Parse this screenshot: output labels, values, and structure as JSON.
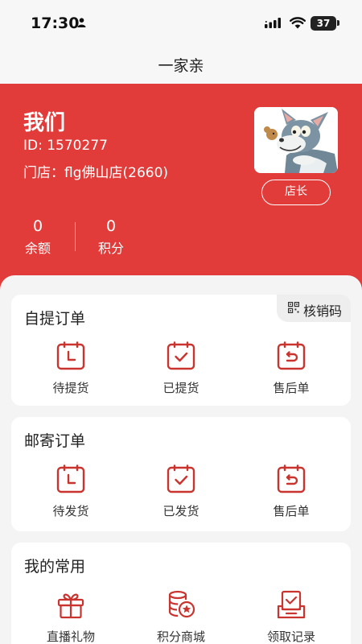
{
  "status_bar": {
    "time": "17:30",
    "battery": "37"
  },
  "nav": {
    "title": "一家亲"
  },
  "profile": {
    "name": "我们",
    "id_line": "ID: 1570277",
    "store_line": "门店：flg佛山店(2660)",
    "role_button": "店长"
  },
  "stats": {
    "balance": {
      "value": "0",
      "label": "余额"
    },
    "points": {
      "value": "0",
      "label": "积分"
    }
  },
  "pickup": {
    "title": "自提订单",
    "verify_label": "核销码",
    "items": [
      {
        "label": "待提货",
        "icon": "clock-box-icon"
      },
      {
        "label": "已提货",
        "icon": "check-box-icon"
      },
      {
        "label": "售后单",
        "icon": "return-box-icon"
      }
    ]
  },
  "mail": {
    "title": "邮寄订单",
    "items": [
      {
        "label": "待发货",
        "icon": "clock-box-icon"
      },
      {
        "label": "已发货",
        "icon": "check-box-icon"
      },
      {
        "label": "售后单",
        "icon": "return-box-icon"
      }
    ]
  },
  "common": {
    "title": "我的常用",
    "items": [
      {
        "label": "直播礼物",
        "icon": "gift-icon"
      },
      {
        "label": "积分商城",
        "icon": "coins-star-icon"
      },
      {
        "label": "领取记录",
        "icon": "claim-record-icon"
      }
    ]
  },
  "colors": {
    "brand_red": "#e23c3a",
    "icon_red": "#c9342f"
  }
}
